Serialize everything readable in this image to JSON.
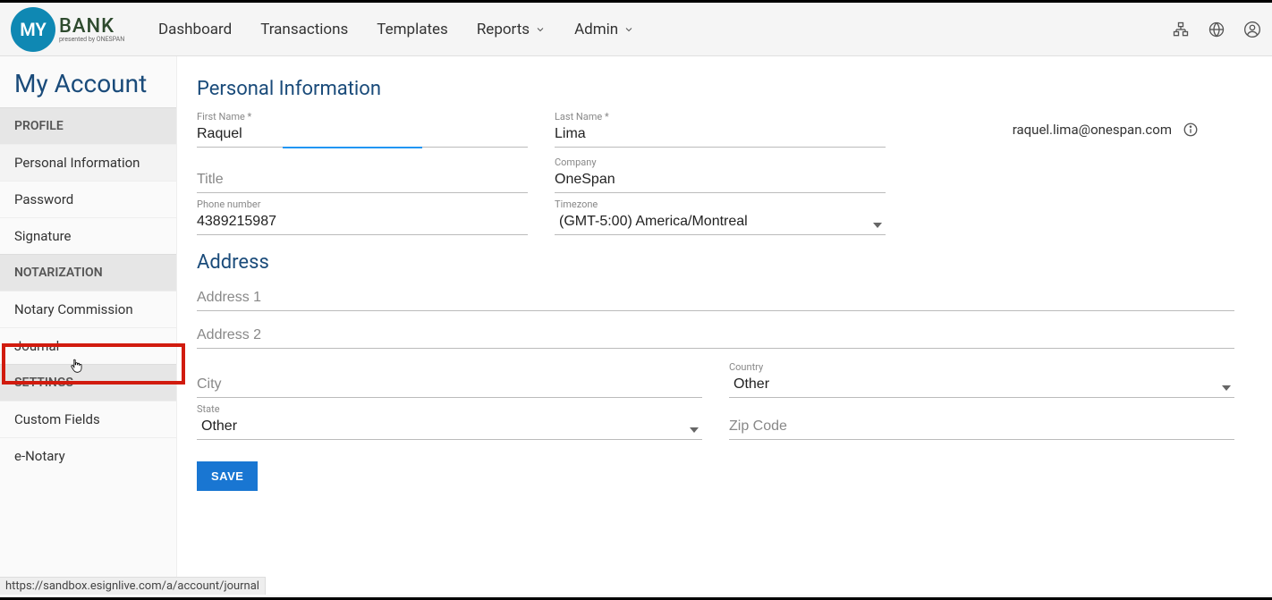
{
  "logo": {
    "circle": "MY",
    "text": "BANK",
    "subtext": "presented by ONESPAN"
  },
  "nav": {
    "dashboard": "Dashboard",
    "transactions": "Transactions",
    "templates": "Templates",
    "reports": "Reports",
    "admin": "Admin"
  },
  "page_title": "My Account",
  "sidebar": {
    "sections": {
      "profile": {
        "header": "PROFILE",
        "items": [
          "Personal Information",
          "Password",
          "Signature"
        ]
      },
      "notarization": {
        "header": "NOTARIZATION",
        "items": [
          "Notary Commission",
          "Journal"
        ]
      },
      "settings": {
        "header": "SETTINGS",
        "items": [
          "Custom Fields",
          "e-Notary"
        ]
      }
    }
  },
  "content": {
    "section_personal": "Personal Information",
    "first_name_label": "First Name *",
    "first_name": "Raquel",
    "last_name_label": "Last Name *",
    "last_name": "Lima",
    "email": "raquel.lima@onespan.com",
    "title_placeholder": "Title",
    "company_label": "Company",
    "company": "OneSpan",
    "phone_label": "Phone number",
    "phone": "4389215987",
    "timezone_label": "Timezone",
    "timezone": "(GMT-5:00) America/Montreal",
    "section_address": "Address",
    "address1_placeholder": "Address 1",
    "address2_placeholder": "Address 2",
    "city_placeholder": "City",
    "country_label": "Country",
    "country": "Other",
    "state_label": "State",
    "state": "Other",
    "zip_placeholder": "Zip Code",
    "save": "SAVE"
  },
  "status_url": "https://sandbox.esignlive.com/a/account/journal"
}
